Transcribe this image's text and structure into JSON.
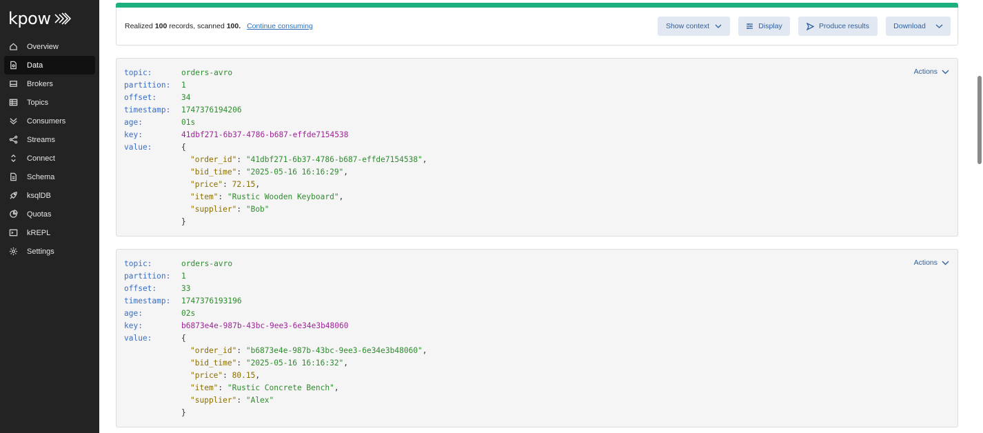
{
  "app": {
    "logo": "kpow"
  },
  "sidebar": {
    "items": [
      {
        "label": "Overview",
        "icon": "home-icon"
      },
      {
        "label": "Data",
        "icon": "file-icon",
        "active": true
      },
      {
        "label": "Brokers",
        "icon": "server-icon"
      },
      {
        "label": "Topics",
        "icon": "table-icon"
      },
      {
        "label": "Consumers",
        "icon": "chevrons-icon"
      },
      {
        "label": "Streams",
        "icon": "share-icon"
      },
      {
        "label": "Connect",
        "icon": "connect-icon"
      },
      {
        "label": "Schema",
        "icon": "document-icon"
      },
      {
        "label": "ksqlDB",
        "icon": "rocket-icon"
      },
      {
        "label": "Quotas",
        "icon": "pie-icon"
      },
      {
        "label": "kREPL",
        "icon": "terminal-icon"
      },
      {
        "label": "Settings",
        "icon": "gear-icon"
      }
    ]
  },
  "summary": {
    "realized_prefix": "Realized",
    "realized_count": "100",
    "realized_mid": "records, scanned",
    "scanned_count": "100.",
    "continue_link": "Continue consuming",
    "progress_color": "#1bb07c",
    "progress": 1.0
  },
  "toolbar": {
    "show_context": "Show context",
    "display": "Display",
    "produce_results": "Produce results",
    "download": "Download"
  },
  "labels": {
    "topic": "topic:",
    "partition": "partition:",
    "offset": "offset:",
    "timestamp": "timestamp:",
    "age": "age:",
    "key": "key:",
    "value": "value:",
    "actions": "Actions",
    "open_brace": "{",
    "close_brace": "}"
  },
  "records": [
    {
      "topic": "orders-avro",
      "partition": "1",
      "offset": "34",
      "timestamp": "1747376194206",
      "age": "01s",
      "key": "41dbf271-6b37-4786-b687-effde7154538",
      "value": [
        {
          "k": "\"order_id\"",
          "v": "\"41dbf271-6b37-4786-b687-effde7154538\"",
          "type": "str",
          "comma": ","
        },
        {
          "k": "\"bid_time\"",
          "v": "\"2025-05-16 16:16:29\"",
          "type": "str",
          "comma": ","
        },
        {
          "k": "\"price\"",
          "v": "72.15",
          "type": "num",
          "comma": ","
        },
        {
          "k": "\"item\"",
          "v": "\"Rustic Wooden Keyboard\"",
          "type": "str",
          "comma": ","
        },
        {
          "k": "\"supplier\"",
          "v": "\"Bob\"",
          "type": "str",
          "comma": ""
        }
      ]
    },
    {
      "topic": "orders-avro",
      "partition": "1",
      "offset": "33",
      "timestamp": "1747376193196",
      "age": "02s",
      "key": "b6873e4e-987b-43bc-9ee3-6e34e3b48060",
      "value": [
        {
          "k": "\"order_id\"",
          "v": "\"b6873e4e-987b-43bc-9ee3-6e34e3b48060\"",
          "type": "str",
          "comma": ","
        },
        {
          "k": "\"bid_time\"",
          "v": "\"2025-05-16 16:16:32\"",
          "type": "str",
          "comma": ","
        },
        {
          "k": "\"price\"",
          "v": "80.15",
          "type": "num",
          "comma": ","
        },
        {
          "k": "\"item\"",
          "v": "\"Rustic Concrete Bench\"",
          "type": "str",
          "comma": ","
        },
        {
          "k": "\"supplier\"",
          "v": "\"Alex\"",
          "type": "str",
          "comma": ""
        }
      ]
    }
  ]
}
